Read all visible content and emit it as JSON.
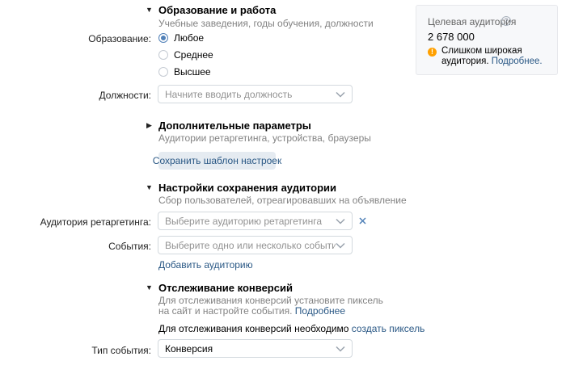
{
  "education_section": {
    "title": "Образование и работа",
    "subtitle": "Учебные заведения, годы обучения, должности",
    "education_label": "Образование:",
    "options": [
      {
        "label": "Любое",
        "selected": true
      },
      {
        "label": "Среднее",
        "selected": false
      },
      {
        "label": "Высшее",
        "selected": false
      }
    ],
    "positions_label": "Должности:",
    "positions_placeholder": "Начните вводить должность"
  },
  "extra_section": {
    "title": "Дополнительные параметры",
    "subtitle": "Аудитории ретаргетинга, устройства, браузеры",
    "save_template_button": "Сохранить шаблон настроек"
  },
  "audience_save_section": {
    "title": "Настройки сохранения аудитории",
    "subtitle": "Сбор пользователей, отреагировавших на объявление",
    "retargeting_label": "Аудитория ретаргетинга:",
    "retargeting_placeholder": "Выберите аудиторию ретаргетинга",
    "events_label": "События:",
    "events_placeholder": "Выберите одно или несколько событий",
    "add_audience_link": "Добавить аудиторию"
  },
  "conversion_section": {
    "title": "Отслеживание конверсий",
    "desc_line1": "Для отслеживания конверсий установите пиксель",
    "desc_line2": "на сайт и настройте события.",
    "more_link": "Подробнее",
    "pixel_text": "Для отслеживания конверсий необходимо",
    "pixel_link": "создать пиксель",
    "event_type_label": "Тип события:",
    "event_type_value": "Конверсия"
  },
  "audience_card": {
    "title": "Целевая аудитория",
    "help_icon": "?",
    "count": "2 678 000",
    "warning_text_line1": "Слишком широкая",
    "warning_text_line2": "аудитория.",
    "warning_link": "Подробнее.",
    "warning_color": "#ffa000",
    "accent_color": "#5181b8"
  }
}
